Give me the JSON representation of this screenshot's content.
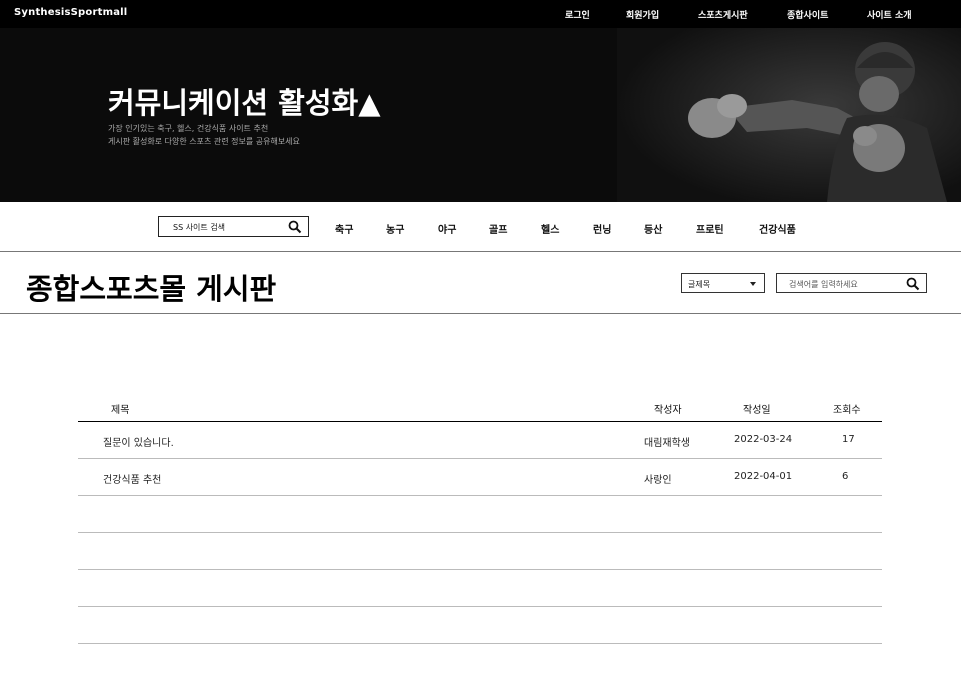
{
  "topbar": {
    "logo": "SynthesisSportmall",
    "nav": [
      "로그인",
      "회원가입",
      "스포츠게시판",
      "종합사이트",
      "사이트 소개"
    ]
  },
  "hero": {
    "title": "커뮤니케이션 활성화▲",
    "subtitle_lines": [
      "가장 인기있는 축구, 헬스, 건강식품 사이트 추천",
      "게시판 활성화로 다양한 스포츠 관련 정보를 공유해보세요"
    ]
  },
  "category_nav": {
    "search_placeholder": "SS 사이트 검색",
    "items": [
      "축구",
      "농구",
      "야구",
      "골프",
      "헬스",
      "런닝",
      "등산",
      "프로틴",
      "건강식품"
    ]
  },
  "board": {
    "title": "종합스포츠몰 게시판",
    "filter_selected": "글제목",
    "search_placeholder": "검색어를 입력하세요",
    "columns": [
      "제목",
      "작성자",
      "작성일",
      "조회수"
    ],
    "rows": [
      {
        "title": "질문이 있습니다.",
        "author": "대림재학생",
        "date": "2022-03-24",
        "views": "17"
      },
      {
        "title": "건강식품 추천",
        "author": "사랑인",
        "date": "2022-04-01",
        "views": "6"
      },
      {
        "title": "",
        "author": "",
        "date": "",
        "views": ""
      },
      {
        "title": "",
        "author": "",
        "date": "",
        "views": ""
      },
      {
        "title": "",
        "author": "",
        "date": "",
        "views": ""
      },
      {
        "title": "",
        "author": "",
        "date": "",
        "views": ""
      }
    ]
  },
  "colors": {
    "topbar_bg": "#000000",
    "hero_bg": "#0b0b0b",
    "text_primary": "#111111",
    "divider": "#bbbbbb"
  }
}
